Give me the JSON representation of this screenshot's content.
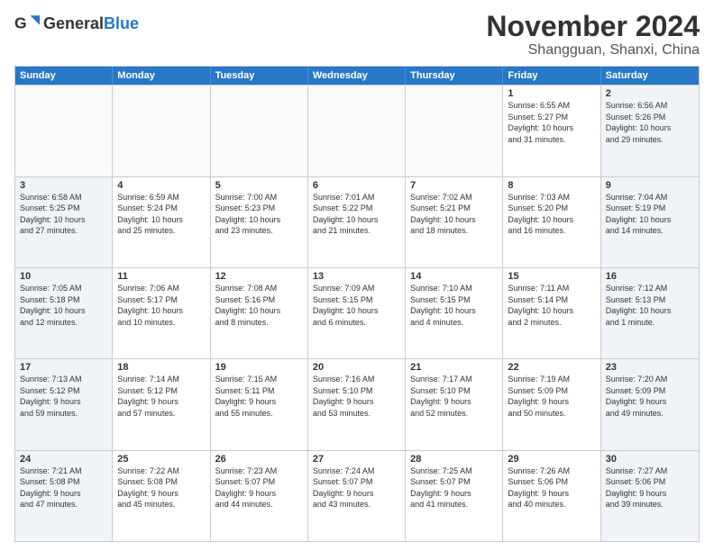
{
  "header": {
    "logo_general": "General",
    "logo_blue": "Blue",
    "month": "November 2024",
    "location": "Shangguan, Shanxi, China"
  },
  "weekdays": [
    "Sunday",
    "Monday",
    "Tuesday",
    "Wednesday",
    "Thursday",
    "Friday",
    "Saturday"
  ],
  "weeks": [
    [
      {
        "day": "",
        "info": "",
        "empty": true
      },
      {
        "day": "",
        "info": "",
        "empty": true
      },
      {
        "day": "",
        "info": "",
        "empty": true
      },
      {
        "day": "",
        "info": "",
        "empty": true
      },
      {
        "day": "",
        "info": "",
        "empty": true
      },
      {
        "day": "1",
        "info": "Sunrise: 6:55 AM\nSunset: 5:27 PM\nDaylight: 10 hours\nand 31 minutes."
      },
      {
        "day": "2",
        "info": "Sunrise: 6:56 AM\nSunset: 5:26 PM\nDaylight: 10 hours\nand 29 minutes."
      }
    ],
    [
      {
        "day": "3",
        "info": "Sunrise: 6:58 AM\nSunset: 5:25 PM\nDaylight: 10 hours\nand 27 minutes."
      },
      {
        "day": "4",
        "info": "Sunrise: 6:59 AM\nSunset: 5:24 PM\nDaylight: 10 hours\nand 25 minutes."
      },
      {
        "day": "5",
        "info": "Sunrise: 7:00 AM\nSunset: 5:23 PM\nDaylight: 10 hours\nand 23 minutes."
      },
      {
        "day": "6",
        "info": "Sunrise: 7:01 AM\nSunset: 5:22 PM\nDaylight: 10 hours\nand 21 minutes."
      },
      {
        "day": "7",
        "info": "Sunrise: 7:02 AM\nSunset: 5:21 PM\nDaylight: 10 hours\nand 18 minutes."
      },
      {
        "day": "8",
        "info": "Sunrise: 7:03 AM\nSunset: 5:20 PM\nDaylight: 10 hours\nand 16 minutes."
      },
      {
        "day": "9",
        "info": "Sunrise: 7:04 AM\nSunset: 5:19 PM\nDaylight: 10 hours\nand 14 minutes."
      }
    ],
    [
      {
        "day": "10",
        "info": "Sunrise: 7:05 AM\nSunset: 5:18 PM\nDaylight: 10 hours\nand 12 minutes."
      },
      {
        "day": "11",
        "info": "Sunrise: 7:06 AM\nSunset: 5:17 PM\nDaylight: 10 hours\nand 10 minutes."
      },
      {
        "day": "12",
        "info": "Sunrise: 7:08 AM\nSunset: 5:16 PM\nDaylight: 10 hours\nand 8 minutes."
      },
      {
        "day": "13",
        "info": "Sunrise: 7:09 AM\nSunset: 5:15 PM\nDaylight: 10 hours\nand 6 minutes."
      },
      {
        "day": "14",
        "info": "Sunrise: 7:10 AM\nSunset: 5:15 PM\nDaylight: 10 hours\nand 4 minutes."
      },
      {
        "day": "15",
        "info": "Sunrise: 7:11 AM\nSunset: 5:14 PM\nDaylight: 10 hours\nand 2 minutes."
      },
      {
        "day": "16",
        "info": "Sunrise: 7:12 AM\nSunset: 5:13 PM\nDaylight: 10 hours\nand 1 minute."
      }
    ],
    [
      {
        "day": "17",
        "info": "Sunrise: 7:13 AM\nSunset: 5:12 PM\nDaylight: 9 hours\nand 59 minutes."
      },
      {
        "day": "18",
        "info": "Sunrise: 7:14 AM\nSunset: 5:12 PM\nDaylight: 9 hours\nand 57 minutes."
      },
      {
        "day": "19",
        "info": "Sunrise: 7:15 AM\nSunset: 5:11 PM\nDaylight: 9 hours\nand 55 minutes."
      },
      {
        "day": "20",
        "info": "Sunrise: 7:16 AM\nSunset: 5:10 PM\nDaylight: 9 hours\nand 53 minutes."
      },
      {
        "day": "21",
        "info": "Sunrise: 7:17 AM\nSunset: 5:10 PM\nDaylight: 9 hours\nand 52 minutes."
      },
      {
        "day": "22",
        "info": "Sunrise: 7:19 AM\nSunset: 5:09 PM\nDaylight: 9 hours\nand 50 minutes."
      },
      {
        "day": "23",
        "info": "Sunrise: 7:20 AM\nSunset: 5:09 PM\nDaylight: 9 hours\nand 49 minutes."
      }
    ],
    [
      {
        "day": "24",
        "info": "Sunrise: 7:21 AM\nSunset: 5:08 PM\nDaylight: 9 hours\nand 47 minutes."
      },
      {
        "day": "25",
        "info": "Sunrise: 7:22 AM\nSunset: 5:08 PM\nDaylight: 9 hours\nand 45 minutes."
      },
      {
        "day": "26",
        "info": "Sunrise: 7:23 AM\nSunset: 5:07 PM\nDaylight: 9 hours\nand 44 minutes."
      },
      {
        "day": "27",
        "info": "Sunrise: 7:24 AM\nSunset: 5:07 PM\nDaylight: 9 hours\nand 43 minutes."
      },
      {
        "day": "28",
        "info": "Sunrise: 7:25 AM\nSunset: 5:07 PM\nDaylight: 9 hours\nand 41 minutes."
      },
      {
        "day": "29",
        "info": "Sunrise: 7:26 AM\nSunset: 5:06 PM\nDaylight: 9 hours\nand 40 minutes."
      },
      {
        "day": "30",
        "info": "Sunrise: 7:27 AM\nSunset: 5:06 PM\nDaylight: 9 hours\nand 39 minutes."
      }
    ]
  ]
}
